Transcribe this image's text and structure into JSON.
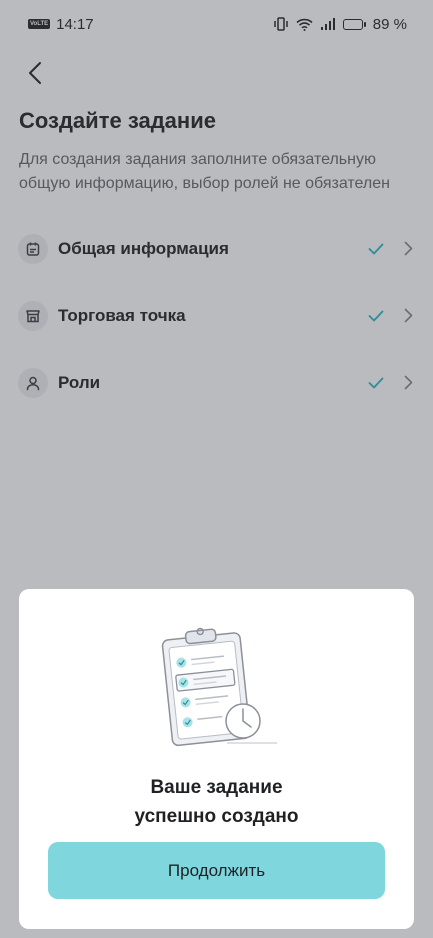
{
  "status_bar": {
    "network_badge": "VoLTE",
    "time": "14:17",
    "battery_percent": "89 %",
    "battery_level": 0.89
  },
  "header": {
    "title": "Создайте задание",
    "subtitle": "Для создания задания заполните обязательную общую информацию, выбор ролей не обязателен"
  },
  "steps": [
    {
      "label": "Общая информация",
      "icon": "calendar-icon",
      "completed": true
    },
    {
      "label": "Торговая точка",
      "icon": "store-icon",
      "completed": true
    },
    {
      "label": "Роли",
      "icon": "person-icon",
      "completed": true
    }
  ],
  "modal": {
    "message_line1": "Ваше задание",
    "message_line2": "успешно создано",
    "continue_label": "Продолжить",
    "illustration": "clipboard-checklist-clock"
  },
  "colors": {
    "accent": "#7fd6dc",
    "check": "#2e8d97",
    "overlay_bg": "#b9bbbf"
  }
}
